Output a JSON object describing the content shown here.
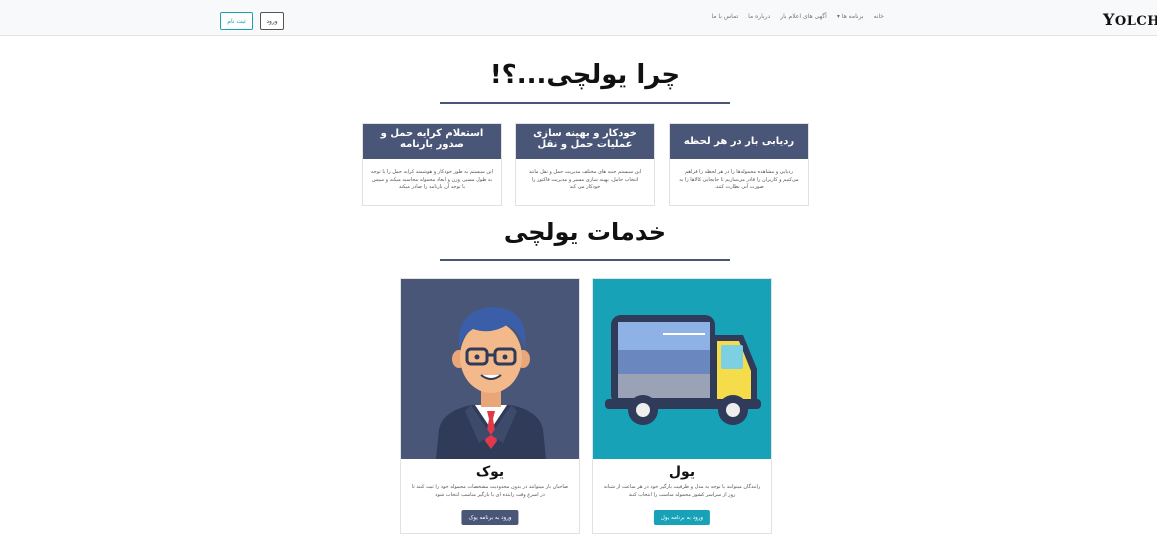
{
  "brand": {
    "first": "Y",
    "rest": "OLCHI"
  },
  "nav": {
    "items": [
      "خانه",
      "برنامه ها ▾",
      "آگهی های اعلام بار",
      "درباره ما",
      "تماس با ما"
    ],
    "login": "ورود",
    "signup": "ثبت نام"
  },
  "why": {
    "title": "چرا یولچی...؟!",
    "features": [
      {
        "title": "ردیابی بار در هر لحظه",
        "body": "ردیابی و مشاهده محموله‌ها را در هر لحظه را فراهم می‌کنیم و کاربران را قادر می‌سازیم تا جابجایی کالاها را به صورت آنی نظارت کنند."
      },
      {
        "title": "خودکار و بهینه سازی عملیات حمل و نقل",
        "body": "این سیستم جنبه های مختلف مدیریت حمل و نقل مانند انتخاب حامل، بهینه سازی مسیر و مدیریت فاکتور را خودکار می کند"
      },
      {
        "title": "استعلام کرایه حمل و صدور بارنامه",
        "body": "این سیستم به طور خودکار و هوشمند کرایه حمل را با توجه به طول مسیر، وزن و ابعاد محموله محاسبه میکند و سپس با توجه آن بارنامه را صادر میکند"
      }
    ]
  },
  "services": {
    "title": "خدمات یولچی",
    "items": [
      {
        "title": "یول",
        "body": "رانندگان میتوانند با توجه به مدل و ظرفیت بارگیر خود در هر ساعت از شبانه روز از سراسر کشور محموله مناسب را انتخاب کنند",
        "button": "ورود به برنامه یول",
        "icon": "truck-icon",
        "color": "#17a2b8"
      },
      {
        "title": "یوک",
        "body": "صاحبان بار میتوانند در بدون محدودیت مشخصات محموله خود را ثبت کنند تا در اسرع وقت راننده ای با بارگیر مناسب انتخاب شود",
        "button": "ورود به برنامه یوک",
        "icon": "businessman-avatar-icon",
        "color": "#4a5678"
      }
    ]
  }
}
